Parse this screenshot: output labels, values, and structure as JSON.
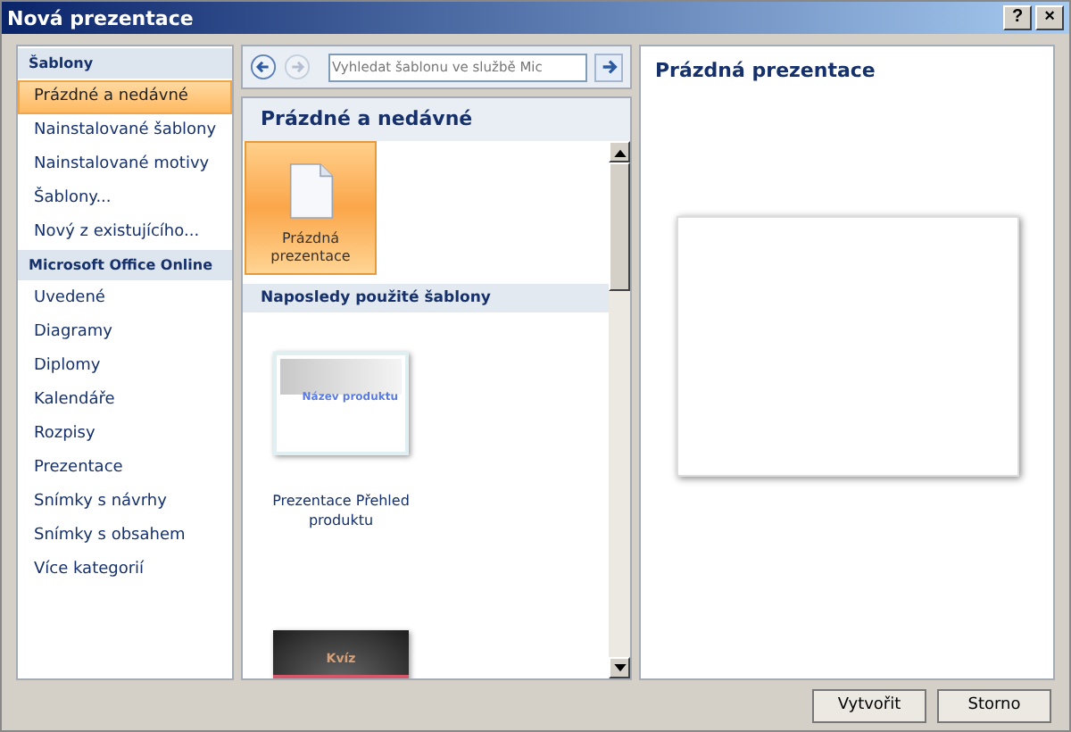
{
  "window": {
    "title": "Nová prezentace",
    "help": "?",
    "close": "×"
  },
  "sidebar": {
    "items": [
      {
        "kind": "header",
        "label": "Šablony"
      },
      {
        "kind": "item",
        "label": "Prázdné a nedávné",
        "selected": true
      },
      {
        "kind": "item",
        "label": "Nainstalované šablony",
        "selected": false
      },
      {
        "kind": "item",
        "label": "Nainstalované motivy",
        "selected": false
      },
      {
        "kind": "item",
        "label": "Šablony...",
        "selected": false
      },
      {
        "kind": "item",
        "label": "Nový z existujícího...",
        "selected": false
      },
      {
        "kind": "header",
        "label": "Microsoft Office Online"
      },
      {
        "kind": "item",
        "label": "Uvedené",
        "selected": false
      },
      {
        "kind": "item",
        "label": "Diagramy",
        "selected": false
      },
      {
        "kind": "item",
        "label": "Diplomy",
        "selected": false
      },
      {
        "kind": "item",
        "label": "Kalendáře",
        "selected": false
      },
      {
        "kind": "item",
        "label": "Rozpisy",
        "selected": false
      },
      {
        "kind": "item",
        "label": "Prezentace",
        "selected": false
      },
      {
        "kind": "item",
        "label": "Snímky s návrhy",
        "selected": false
      },
      {
        "kind": "item",
        "label": "Snímky s obsahem",
        "selected": false
      },
      {
        "kind": "item",
        "label": "Více kategorií",
        "selected": false
      }
    ]
  },
  "search": {
    "placeholder": "Vyhledat šablonu ve službě Mic"
  },
  "gallery": {
    "title": "Prázdné a nedávné",
    "blank": {
      "label": "Prázdná prezentace",
      "selected": true
    },
    "section": "Naposledy použité šablony",
    "templates": [
      {
        "kind": "light",
        "thumb_text": "Název produktu",
        "label": "Prezentace Přehled produktu"
      },
      {
        "kind": "dark",
        "thumb_text": "Kvíz"
      }
    ]
  },
  "preview": {
    "title": "Prázdná prezentace"
  },
  "buttons": [
    "Vytvořit",
    "Storno"
  ]
}
